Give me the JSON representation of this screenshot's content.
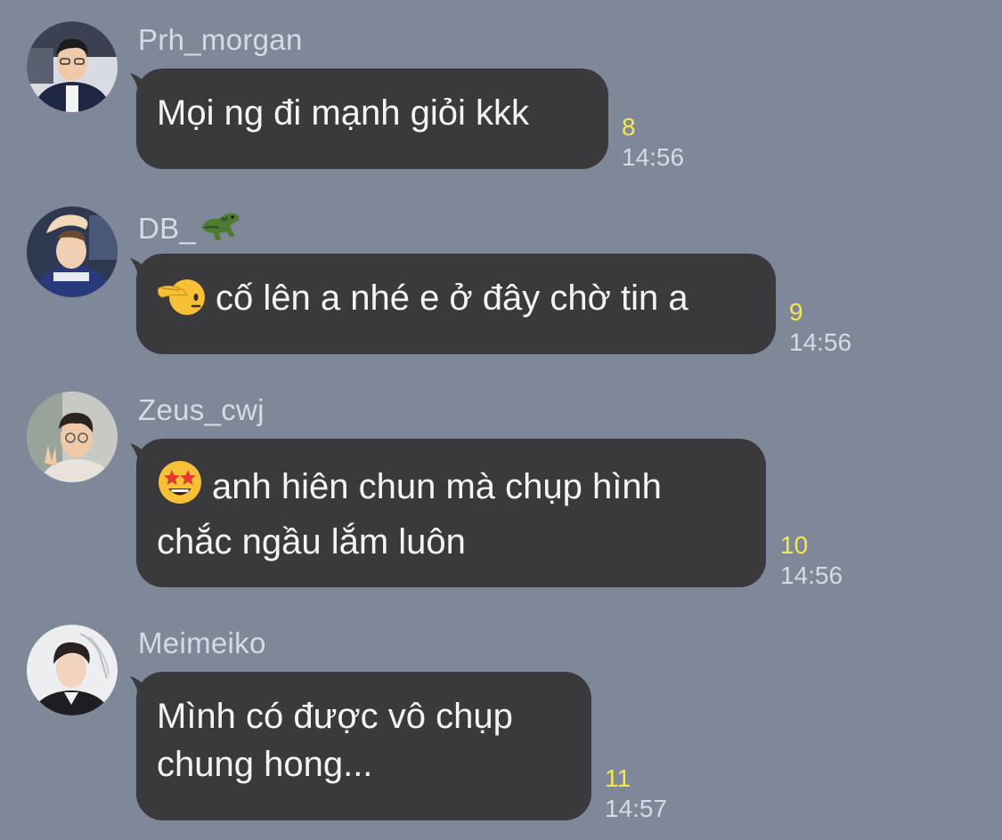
{
  "messages": [
    {
      "sender": "Prh_morgan",
      "lines": [
        "Mọi ng đi mạnh giỏi kkk"
      ],
      "read_count": "8",
      "time": "14:56",
      "emoji": null
    },
    {
      "sender": "DB_",
      "sender_emoji": "crocodile-icon",
      "lines": [
        "cố lên a nhé e ở đây chờ tin a"
      ],
      "read_count": "9",
      "time": "14:56",
      "emoji": "saluting-face-icon"
    },
    {
      "sender": "Zeus_cwj",
      "lines": [
        "anh hiên chun mà chụp hình",
        "chắc ngầu lắm luôn"
      ],
      "read_count": "10",
      "time": "14:56",
      "emoji": "star-struck-icon"
    },
    {
      "sender": "Meimeiko",
      "lines": [
        "Mình có được vô chụp",
        "chung hong..."
      ],
      "read_count": "11",
      "time": "14:57",
      "emoji": null
    }
  ],
  "colors": {
    "background": "#7f8898",
    "bubble": "#3a3a3c",
    "read_count": "#f6e84a",
    "meta_text": "#d6dae2"
  }
}
